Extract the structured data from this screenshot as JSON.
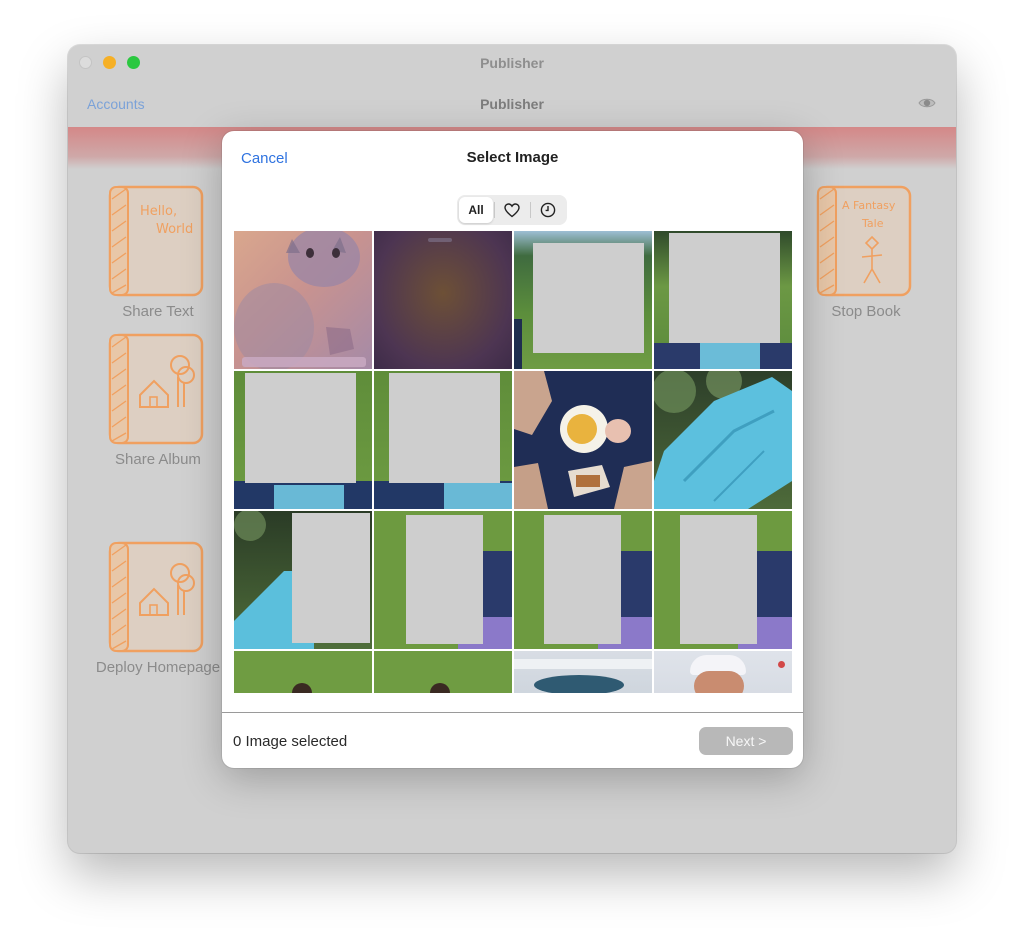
{
  "window": {
    "title": "Publisher"
  },
  "navbar": {
    "accounts_label": "Accounts",
    "title": "Publisher",
    "right_icon": "eye-icon"
  },
  "books": [
    {
      "label": "Share Text",
      "cover_text": [
        "Hello,",
        "World"
      ]
    },
    {
      "label": "Share Album",
      "icon": "house-tree-icon"
    },
    {
      "label": "Deploy Homepage",
      "icon": "house-tree-icon"
    },
    {
      "label": "Stop Book",
      "cover_text": [
        "A Fantasy",
        "Tale"
      ]
    }
  ],
  "dialog": {
    "cancel_label": "Cancel",
    "title": "Select Image",
    "segments": [
      {
        "label": "All",
        "selected": true
      },
      {
        "icon": "heart-icon"
      },
      {
        "icon": "clock-icon"
      }
    ],
    "selection_status": "0 Image selected",
    "next_label": "Next >"
  },
  "colors": {
    "accent_blue": "#2f73e0",
    "banner": "#d48888",
    "book_orange": "#f0a060",
    "next_disabled": "#b8b8b8"
  }
}
